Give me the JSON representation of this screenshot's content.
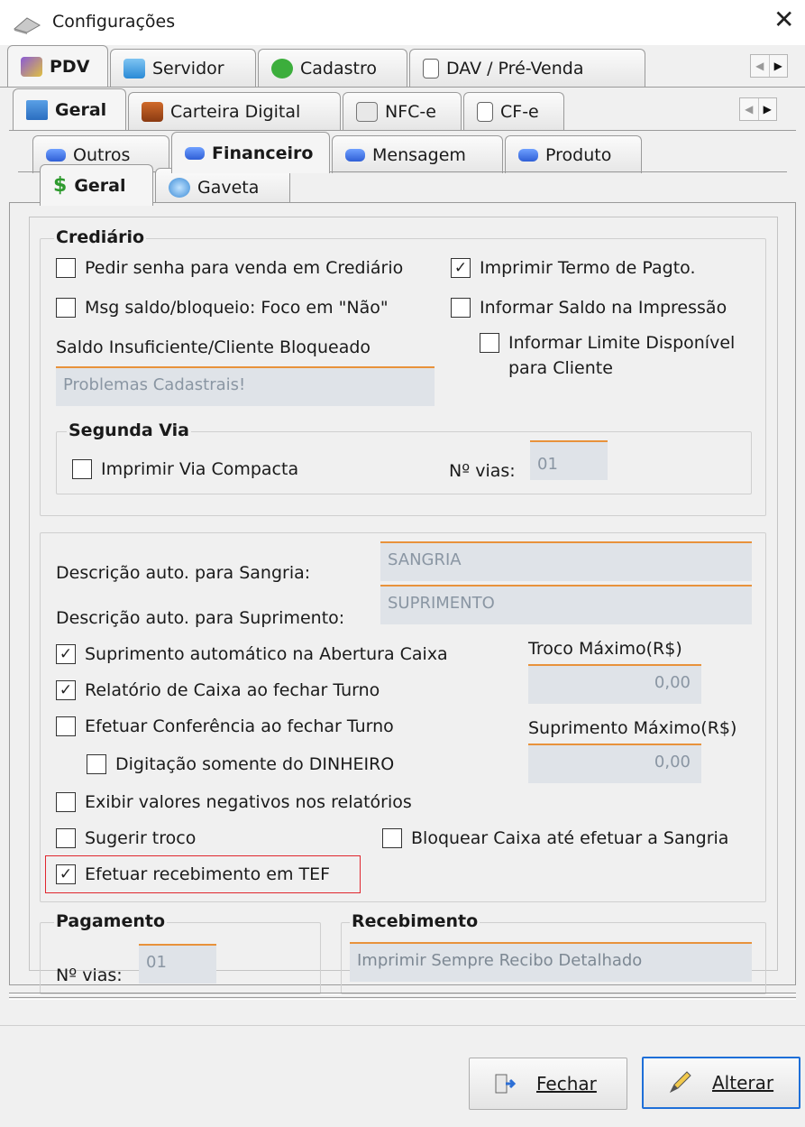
{
  "window": {
    "title": "Configurações",
    "close_glyph": "✕"
  },
  "tabs_level1": [
    "PDV",
    "Servidor",
    "Cadastro",
    "DAV / Pré-Venda"
  ],
  "tabs_level2": [
    "Geral",
    "Carteira Digital",
    "NFC-e",
    "CF-e"
  ],
  "tabs_level3": [
    "Outros",
    "Financeiro",
    "Mensagem",
    "Produto"
  ],
  "tabs_level4": [
    "Geral",
    "Gaveta"
  ],
  "nav": {
    "left": "◀",
    "right": "▶"
  },
  "crediario": {
    "title": "Crediário",
    "pedir_senha": {
      "label": "Pedir senha para venda em Crediário",
      "checked": false
    },
    "imprimir_termo": {
      "label": "Imprimir Termo de Pagto.",
      "checked": true
    },
    "msg_saldo": {
      "label": "Msg saldo/bloqueio: Foco em \"Não\"",
      "checked": false
    },
    "informar_saldo": {
      "label": "Informar Saldo na Impressão",
      "checked": false
    },
    "saldo_insuf_label": "Saldo Insuficiente/Cliente Bloqueado",
    "saldo_insuf_value": "Problemas Cadastrais!",
    "informar_limite": {
      "label_line1": "Informar Limite Disponível",
      "label_line2": "para Cliente",
      "checked": false
    },
    "segunda_via": {
      "title": "Segunda Via",
      "imprimir_compacta": {
        "label": "Imprimir Via Compacta",
        "checked": false
      },
      "vias_label": "Nº vias:",
      "vias_value": "01"
    }
  },
  "caixa": {
    "desc_sangria_label": "Descrição auto. para Sangria:",
    "desc_sangria_value": "SANGRIA",
    "desc_suprimento_label": "Descrição auto. para Suprimento:",
    "desc_suprimento_value": "SUPRIMENTO",
    "suprimento_auto": {
      "label": "Suprimento automático na Abertura Caixa",
      "checked": true
    },
    "relatorio_caixa": {
      "label": "Relatório de Caixa ao fechar Turno",
      "checked": true
    },
    "efetuar_conferencia": {
      "label": "Efetuar Conferência ao fechar Turno",
      "checked": false
    },
    "digitacao_dinheiro": {
      "label": "Digitação somente do DINHEIRO",
      "checked": false
    },
    "exibir_negativos": {
      "label": "Exibir valores negativos nos relatórios",
      "checked": false
    },
    "sugerir_troco": {
      "label": "Sugerir troco",
      "checked": false
    },
    "bloquear_caixa": {
      "label": "Bloquear Caixa até efetuar a Sangria",
      "checked": false
    },
    "efetuar_tef": {
      "label": "Efetuar recebimento em TEF",
      "checked": true
    },
    "troco_max_label": "Troco Máximo(R$)",
    "troco_max_value": "0,00",
    "suprimento_max_label": "Suprimento Máximo(R$)",
    "suprimento_max_value": "0,00"
  },
  "pagamento": {
    "title": "Pagamento",
    "vias_label": "Nº vias:",
    "vias_value": "01"
  },
  "recebimento": {
    "title": "Recebimento",
    "value": "Imprimir Sempre Recibo Detalhado"
  },
  "buttons": {
    "fechar": "Fechar",
    "alterar": "Alterar"
  },
  "check_glyph": "✓",
  "colors": {
    "field_bg": "#dfe3e8",
    "field_accent": "#e8923b",
    "highlight": "#e0262e",
    "default_button": "#1e6fd8"
  }
}
